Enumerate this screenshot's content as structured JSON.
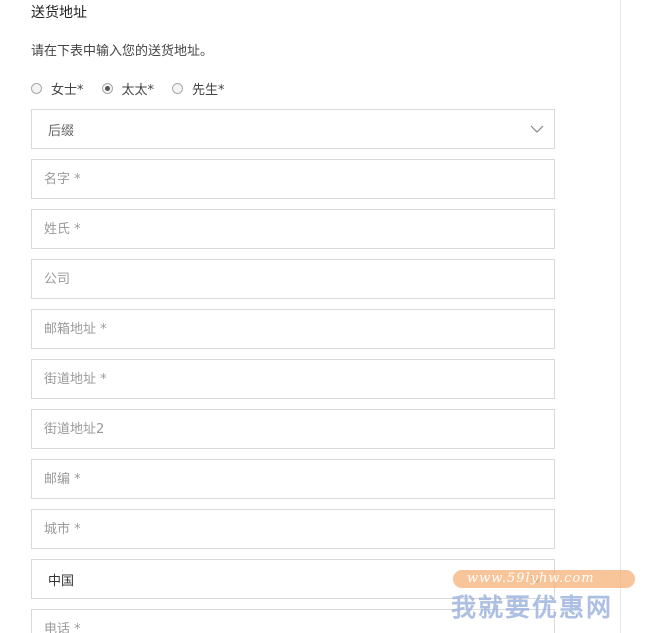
{
  "form": {
    "title": "送货地址",
    "instruction": "请在下表中输入您的送货地址。",
    "salutation": {
      "options": [
        {
          "label": "女士*",
          "checked": false
        },
        {
          "label": "太太*",
          "checked": true
        },
        {
          "label": "先生*",
          "checked": false
        }
      ]
    },
    "suffix": {
      "value": "后缀",
      "icon": "chevron-down-icon"
    },
    "fields": {
      "first_name": {
        "placeholder": "名字 *",
        "value": ""
      },
      "last_name": {
        "placeholder": "姓氏 *",
        "value": ""
      },
      "company": {
        "placeholder": "公司",
        "value": ""
      },
      "email": {
        "placeholder": "邮箱地址 *",
        "value": ""
      },
      "street": {
        "placeholder": "街道地址 *",
        "value": ""
      },
      "street2": {
        "placeholder": "街道地址2",
        "value": ""
      },
      "zip": {
        "placeholder": "邮编 *",
        "value": ""
      },
      "city": {
        "placeholder": "城市 *",
        "value": ""
      },
      "phone": {
        "placeholder": "电话 *",
        "value": ""
      }
    },
    "country": {
      "value": "中国",
      "icon": "chevron-down-icon"
    }
  },
  "watermark": {
    "url": "www.59lyhw.com",
    "text": "我就要优惠网"
  },
  "colors": {
    "border": "#d9d9d9",
    "placeholder": "#9a9a9a",
    "watermark_pill": "#f5b27a",
    "watermark_text": "#9fb4de"
  }
}
